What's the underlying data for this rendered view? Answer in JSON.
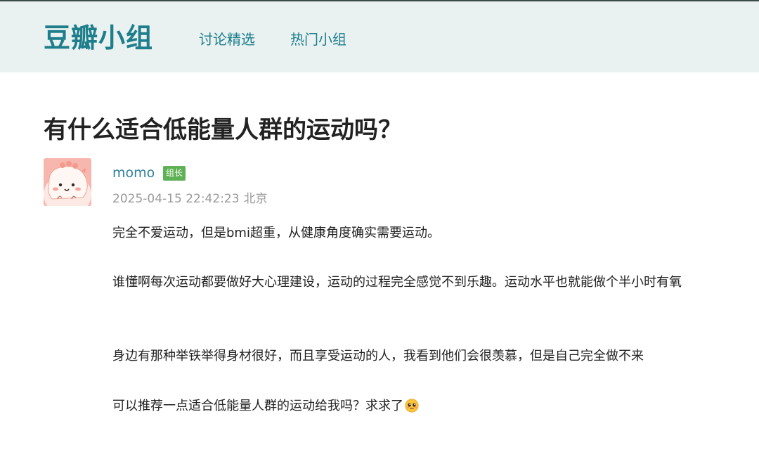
{
  "header": {
    "logo": "豆瓣小组",
    "nav": [
      {
        "label": "讨论精选"
      },
      {
        "label": "热门小组"
      }
    ]
  },
  "post": {
    "title": "有什么适合低能量人群的运动吗？",
    "author": "momo",
    "badge": "组长",
    "datetime": "2025-04-15 22:42:23",
    "location": "北京",
    "paragraphs": [
      "完全不爱运动，但是bmi超重，从健康角度确实需要运动。",
      "谁懂啊每次运动都要做好大心理建设，运动的过程完全感觉不到乐趣。运动水平也就能做个半小时有氧",
      "身边有那种举铁举得身材很好，而且享受运动的人，我看到他们会很羡慕，但是自己完全做不来",
      "可以推荐一点适合低能量人群的运动给我吗？求求了"
    ],
    "trailing_emoji": "pleading-face-emoji"
  },
  "colors": {
    "brand": "#1f7e8c",
    "header_bg": "#e9f2f1",
    "author_link": "#2f7f9e",
    "badge_bg": "#5fb155",
    "meta_text": "#999999"
  }
}
